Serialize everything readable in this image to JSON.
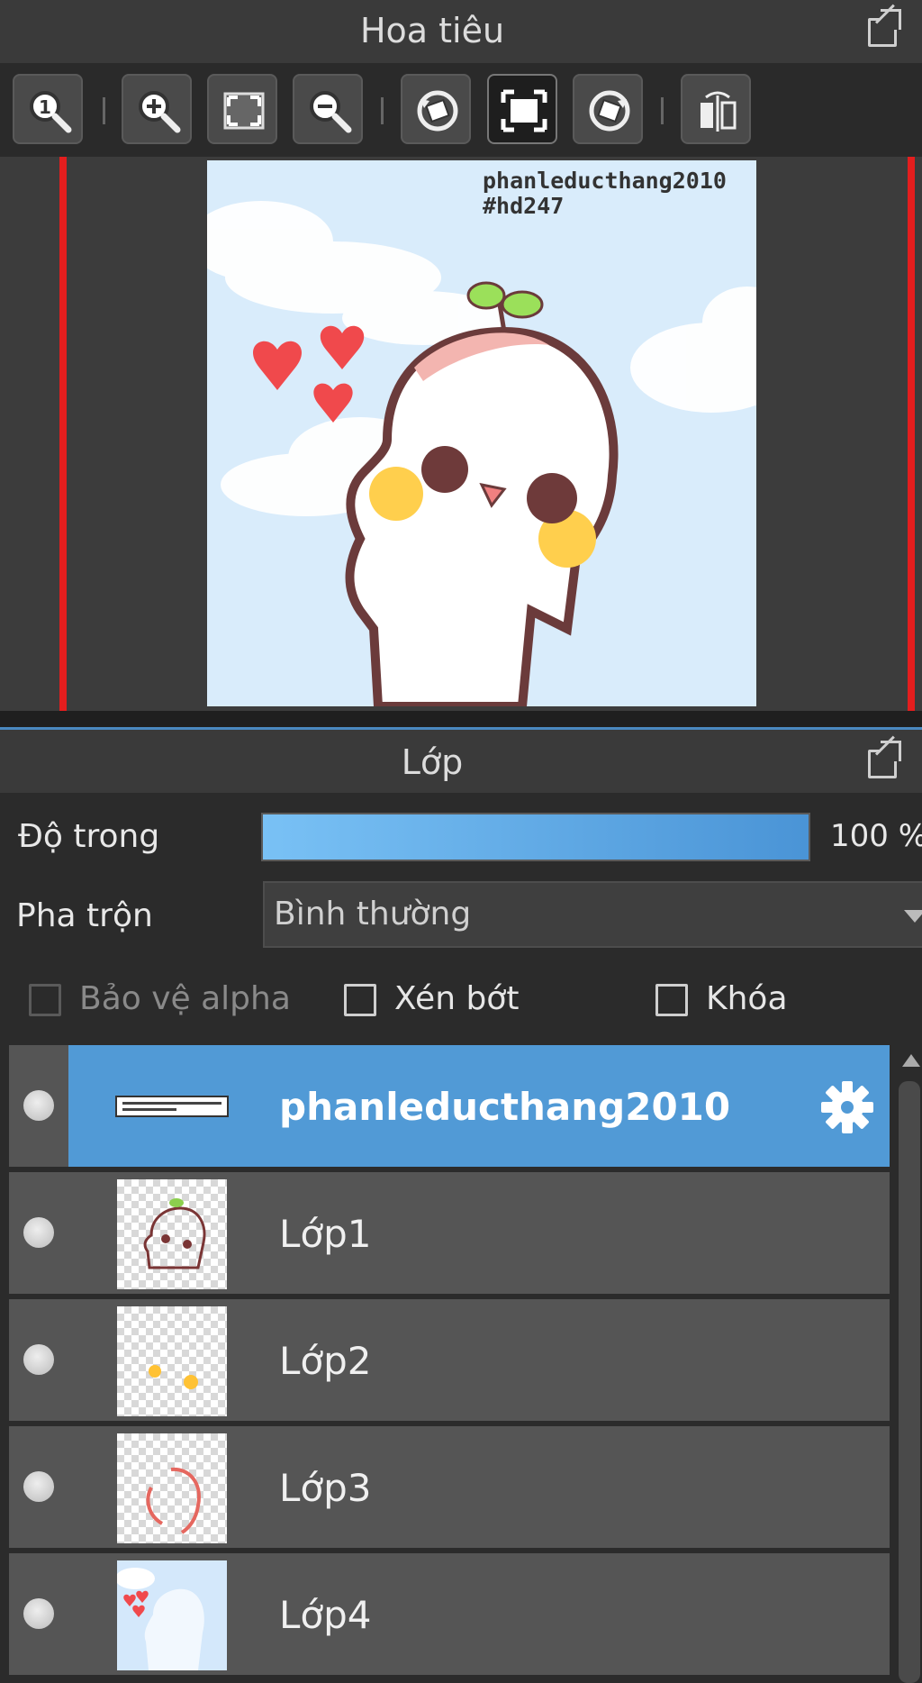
{
  "navigator": {
    "title": "Hoa tiêu",
    "watermark_line1": "phanleducthang2010",
    "watermark_line2": "#hd247",
    "toolbar": [
      "zoom-actual-size",
      "zoom-in",
      "fit-to-window",
      "zoom-out",
      "rotate-left",
      "fit-canvas",
      "rotate-right",
      "flip-horizontal"
    ]
  },
  "layers_panel": {
    "title": "Lớp",
    "opacity_label": "Độ trong",
    "opacity_value": "100 %",
    "opacity_fraction": 1.0,
    "blend_label": "Pha trộn",
    "blend_value": "Bình thường",
    "protect_alpha_label": "Bảo vệ alpha",
    "clipping_label": "Xén bớt",
    "lock_label": "Khóa",
    "layers": [
      {
        "name": "phanleducthang2010",
        "selected": true
      },
      {
        "name": "Lớp1",
        "selected": false
      },
      {
        "name": "Lớp2",
        "selected": false
      },
      {
        "name": "Lớp3",
        "selected": false
      },
      {
        "name": "Lớp4",
        "selected": false
      }
    ]
  },
  "colors": {
    "accent": "#519ad6",
    "red_border": "#e41e1e",
    "sky": "#d9ecfb"
  }
}
